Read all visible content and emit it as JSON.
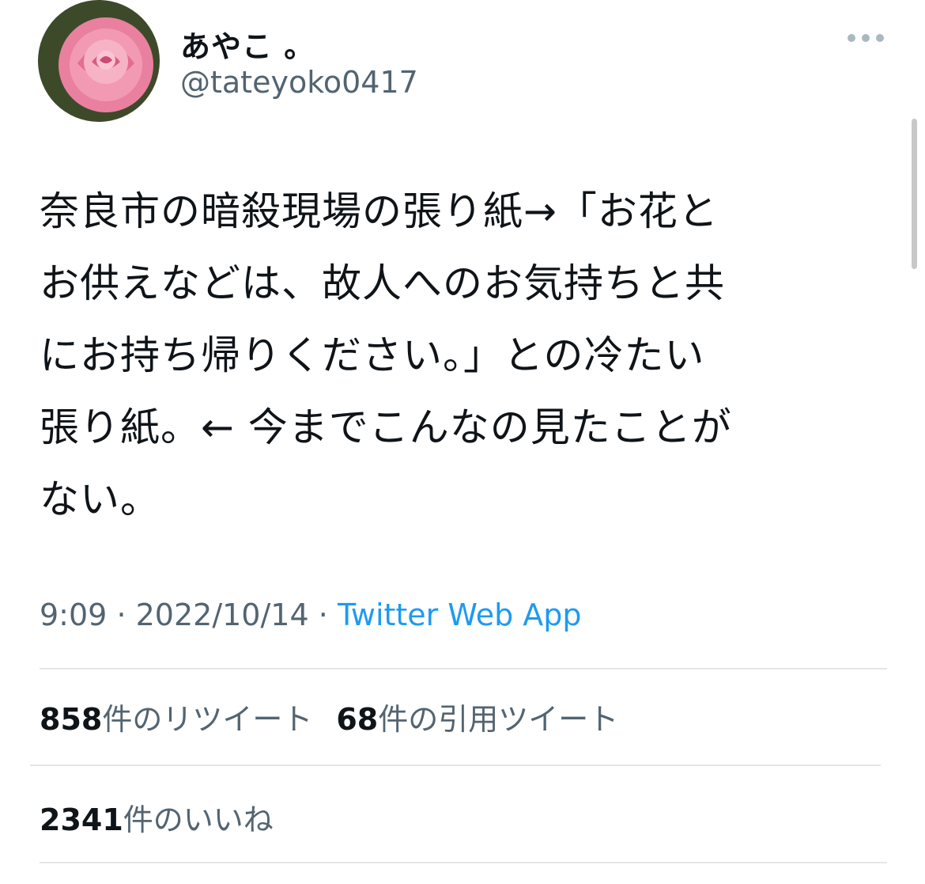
{
  "tweet": {
    "display_name": "あやこ 。",
    "handle": "@tateyoko0417",
    "text": "奈良市の暗殺現場の張り紙→「お花と\nお供えなどは、故人へのお気持ちと共\nにお持ち帰りください。」との冷たい\n張り紙。← 今までこんなの見たことが\nない。",
    "time": "9:09",
    "separator": "·",
    "date": "2022/10/14",
    "client": "Twitter Web App"
  },
  "stats": {
    "retweets_count": "858",
    "retweets_label": "件のリツイート",
    "quotes_count": "68",
    "quotes_label": "件の引用ツイート",
    "likes_count": "2341",
    "likes_label": "件のいいね"
  },
  "icons": {
    "more": "more-horizontal-icon",
    "avatar": "rose-avatar-image"
  },
  "colors": {
    "link": "#1d9bf0",
    "secondary_text": "#536471"
  }
}
